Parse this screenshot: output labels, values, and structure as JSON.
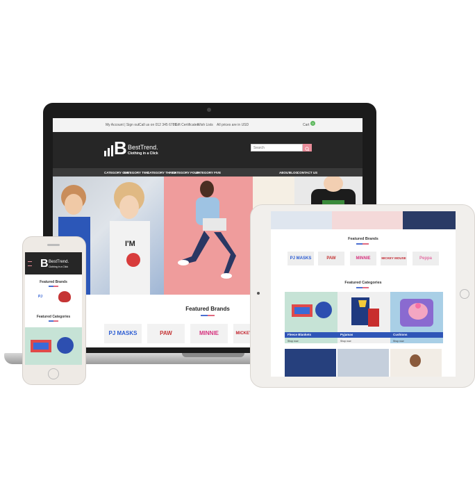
{
  "laptop": {
    "topbar": {
      "account": "My Account | Sign out",
      "phone": "Call us on 012 345 6789",
      "gift": "Gift Certificates",
      "wishlist": "Wish Lists",
      "currency": "All prices are in USD",
      "cart_label": "Cart",
      "cart_count": "0"
    },
    "logo": {
      "letter": "B",
      "name": "BestTrend.",
      "tagline": "Clothing in a Click"
    },
    "search": {
      "placeholder": "Search"
    },
    "nav": {
      "left": [
        "CATEGORY ONE",
        "CATEGORY TWO",
        "CATEGORY THREE",
        "CATEGORY FOUR",
        "CATEGORY FIVE"
      ],
      "right": [
        "ABOUT",
        "BLOG",
        "CONTACT US"
      ]
    },
    "featured_brands_title": "Featured Brands",
    "brands": [
      "PJ MASKS",
      "PAW",
      "MINNIE",
      "MICKEY MOUSE"
    ]
  },
  "tablet": {
    "featured_brands_title": "Featured Brands",
    "brands": [
      "PJ MASKS",
      "PAW",
      "MINNIE",
      "MICKEY MOUSE",
      "Peppa"
    ],
    "featured_categories_title": "Featured Categories",
    "categories": [
      {
        "label": "Fleece Blankets",
        "cta": "Shop now"
      },
      {
        "label": "Pyjamas",
        "cta": "Shop now"
      },
      {
        "label": "Cushions",
        "cta": "Shop now"
      }
    ]
  },
  "phone": {
    "logo_name": "BestTrend.",
    "logo_tagline": "Clothing in a Click",
    "featured_brands_title": "Featured Brands",
    "featured_categories_title": "Featured Categories"
  },
  "colors": {
    "dark": "#262626",
    "accent_pink": "#e98c99",
    "accent_blue": "#2f55b7",
    "badge_green": "#5cb85c"
  }
}
